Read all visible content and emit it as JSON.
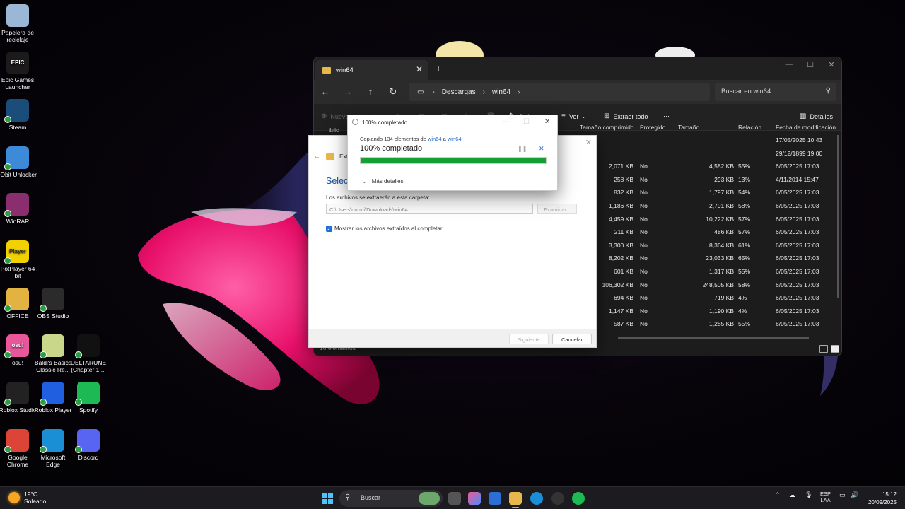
{
  "desktop": {
    "icons": [
      {
        "label": "Papelera de reciclaje",
        "icon": "recycle-bin-icon",
        "color": "#9ab7d6"
      },
      {
        "label": "Epic Games Launcher",
        "icon": "epic-games-icon",
        "color": "#1b1b1b",
        "glyph": "EPIC"
      },
      {
        "label": "Steam",
        "icon": "steam-icon",
        "color": "#1b4d7a"
      },
      {
        "label": "IObit Unlocker",
        "icon": "lock-icon",
        "color": "#3d8bd8"
      },
      {
        "label": "WinRAR",
        "icon": "winrar-icon",
        "color": "#8a2e6e"
      },
      {
        "label": "PotPlayer 64 bit",
        "icon": "potplayer-icon",
        "color": "#f2d100",
        "glyph": "Player"
      },
      {
        "label": "OFFICE",
        "icon": "folder-icon",
        "color": "#e3b341"
      },
      {
        "label": "OBS Studio",
        "icon": "obs-icon",
        "color": "#2b2b2b"
      },
      {
        "label": "osu!",
        "icon": "osu-icon",
        "color": "#e8569b",
        "glyph": "osu!"
      },
      {
        "label": "Baldi's Basics Classic Re...",
        "icon": "baldi-icon",
        "color": "#c9d78a"
      },
      {
        "label": "DELTARUNE (Chapter 1 ...",
        "icon": "deltarune-icon",
        "color": "#111111"
      },
      {
        "label": "Roblox Studio",
        "icon": "roblox-studio-icon",
        "color": "#222222"
      },
      {
        "label": "Roblox Player",
        "icon": "roblox-icon",
        "color": "#1f5fe0"
      },
      {
        "label": "Spotify",
        "icon": "spotify-icon",
        "color": "#1db954"
      },
      {
        "label": "Google Chrome",
        "icon": "chrome-icon",
        "color": "#db4437"
      },
      {
        "label": "Microsoft Edge",
        "icon": "edge-icon",
        "color": "#1a8fd6"
      },
      {
        "label": "Discord",
        "icon": "discord-icon",
        "color": "#5865f2"
      }
    ]
  },
  "explorer": {
    "tab_title": "win64",
    "new_tab": "+",
    "breadcrumb": [
      "Descargas",
      "win64"
    ],
    "search_placeholder": "Buscar en win64",
    "toolbar": {
      "new": "Nuevo",
      "sort": "Ordenar",
      "view": "Ver",
      "extract_all": "Extraer todo",
      "more": "···",
      "details": "Detalles"
    },
    "sidebar_partial": "Inic",
    "columns": [
      "Tamaño comprimido",
      "Protegido ...",
      "Tamaño",
      "Relación",
      "Fecha de modificación"
    ],
    "rows": [
      {
        "compressed": "",
        "protected": "",
        "size": "",
        "ratio": "",
        "date": "17/05/2025 10:43"
      },
      {
        "compressed": "",
        "protected": "",
        "size": "",
        "ratio": "",
        "date": "29/12/1899 19:00"
      },
      {
        "compressed": "2,071 KB",
        "protected": "No",
        "size": "4,582 KB",
        "ratio": "55%",
        "date": "6/05/2025 17:03"
      },
      {
        "compressed": "258 KB",
        "protected": "No",
        "size": "293 KB",
        "ratio": "13%",
        "date": "4/11/2014 15:47"
      },
      {
        "compressed": "832 KB",
        "protected": "No",
        "size": "1,797 KB",
        "ratio": "54%",
        "date": "6/05/2025 17:03"
      },
      {
        "compressed": "1,186 KB",
        "protected": "No",
        "size": "2,791 KB",
        "ratio": "58%",
        "date": "6/05/2025 17:03"
      },
      {
        "compressed": "4,459 KB",
        "protected": "No",
        "size": "10,222 KB",
        "ratio": "57%",
        "date": "6/05/2025 17:03"
      },
      {
        "compressed": "211 KB",
        "protected": "No",
        "size": "486 KB",
        "ratio": "57%",
        "date": "6/05/2025 17:03"
      },
      {
        "compressed": "3,300 KB",
        "protected": "No",
        "size": "8,364 KB",
        "ratio": "61%",
        "date": "6/05/2025 17:03"
      },
      {
        "compressed": "8,202 KB",
        "protected": "No",
        "size": "23,033 KB",
        "ratio": "65%",
        "date": "6/05/2025 17:03"
      },
      {
        "compressed": "601 KB",
        "protected": "No",
        "size": "1,317 KB",
        "ratio": "55%",
        "date": "6/05/2025 17:03"
      },
      {
        "compressed": "106,302 KB",
        "protected": "No",
        "size": "248,505 KB",
        "ratio": "58%",
        "date": "6/05/2025 17:03"
      },
      {
        "compressed": "694 KB",
        "protected": "No",
        "size": "719 KB",
        "ratio": "4%",
        "date": "6/05/2025 17:03"
      },
      {
        "compressed": "1,147 KB",
        "protected": "No",
        "size": "1,190 KB",
        "ratio": "4%",
        "date": "6/05/2025 17:03"
      },
      {
        "compressed": "587 KB",
        "protected": "No",
        "size": "1,285 KB",
        "ratio": "55%",
        "date": "6/05/2025 17:03"
      }
    ],
    "status": "16 elementos"
  },
  "wizard": {
    "title_partial": "Extra",
    "heading_partial": "Selecc",
    "dest_label": "Los archivos se extraerán a esta carpeta:",
    "dest_path": "C:\\Users\\dormi\\Downloads\\win64",
    "browse": "Examinar...",
    "show_files": "Mostrar los archivos extraídos al completar",
    "next": "Siguiente",
    "cancel": "Cancelar"
  },
  "progress": {
    "title": "100% completado",
    "copy_prefix": "Copiando 134 elementos de",
    "source": "win64",
    "connector": "a",
    "dest": "win64",
    "status": "100% completado",
    "percent": 100,
    "more": "Más detalles",
    "bar_color": "#16a034"
  },
  "taskbar": {
    "temp": "19°C",
    "weather": "Soleado",
    "search": "Buscar",
    "lang_top": "ESP",
    "lang_bottom": "LAA",
    "time": "15:12",
    "date": "20/09/2025"
  }
}
